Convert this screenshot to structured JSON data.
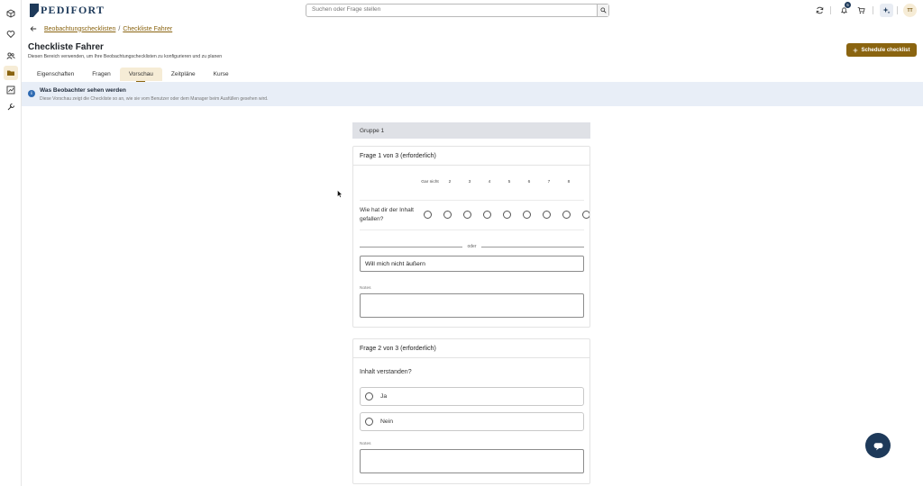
{
  "app": {
    "logo_text": "PEDIFORT"
  },
  "colors": {
    "brand_gold": "#8a6410",
    "brand_navy": "#1e3a5a",
    "banner_bg": "#e8eef7",
    "active_tab_bg": "#f6ecd6"
  },
  "sidebar": {
    "items": [
      {
        "icon": "cube-icon"
      },
      {
        "icon": "heart-icon"
      },
      {
        "icon": "users-icon"
      },
      {
        "icon": "folder-icon",
        "active": true
      },
      {
        "icon": "chart-icon"
      },
      {
        "icon": "tools-icon"
      }
    ]
  },
  "topbar": {
    "search_placeholder": "Suchen oder Frage stellen",
    "notification_count": "5",
    "avatar_initials": "TT"
  },
  "breadcrumb": {
    "parent": "Beobachtungschecklisten",
    "separator": "/",
    "current": "Checkliste Fahrer"
  },
  "page": {
    "title": "Checkliste Fahrer",
    "subtitle": "Diesen Bereich verwenden, um Ihre Beobachtungschecklisten zu konfigurieren und zu planen",
    "schedule_button": "Schedule checklist"
  },
  "tabs": [
    {
      "label": "Eigenschaften"
    },
    {
      "label": "Fragen"
    },
    {
      "label": "Vorschau",
      "active": true
    },
    {
      "label": "Zeitpläne"
    },
    {
      "label": "Kurse"
    }
  ],
  "info_banner": {
    "title": "Was Beobachter sehen werden",
    "text": "Diese Vorschau zeigt die Checkliste so an, wie sie vom Benutzer oder dem Manager beim Ausfüllen gesehen wird."
  },
  "group": {
    "label": "Gruppe 1"
  },
  "question1": {
    "title": "Frage 1 von 3 (erforderlich)",
    "scale_headers": [
      "Gar nicht",
      "2",
      "3",
      "4",
      "5",
      "6",
      "7",
      "8"
    ],
    "question": "Wie hat dir der Inhalt gefallen?",
    "or_label": "oder",
    "optout_value": "Will mich nicht äußern",
    "notes_label": "Notes"
  },
  "question2": {
    "title": "Frage 2 von 3 (erforderlich)",
    "question": "Inhalt verstanden?",
    "options": [
      "Ja",
      "Nein"
    ],
    "notes_label": "Notes"
  }
}
